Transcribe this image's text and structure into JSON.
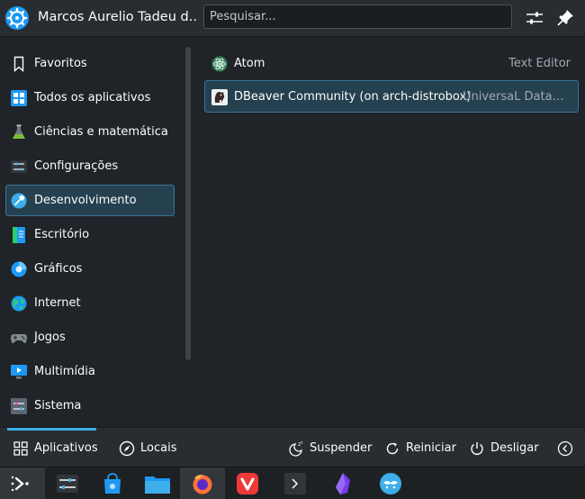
{
  "header": {
    "username": "Marcos Aurelio Tadeu d...",
    "search_placeholder": "Pesquisar..."
  },
  "sidebar": {
    "items": [
      {
        "label": "Favoritos",
        "icon": "bookmark-icon"
      },
      {
        "label": "Todos os aplicativos",
        "icon": "all-apps-icon"
      },
      {
        "label": "Ciências e matemática",
        "icon": "science-icon"
      },
      {
        "label": "Configurações",
        "icon": "settings-icon"
      },
      {
        "label": "Desenvolvimento",
        "icon": "development-icon",
        "active": true
      },
      {
        "label": "Escritório",
        "icon": "office-icon"
      },
      {
        "label": "Gráficos",
        "icon": "graphics-icon"
      },
      {
        "label": "Internet",
        "icon": "internet-icon"
      },
      {
        "label": "Jogos",
        "icon": "games-icon"
      },
      {
        "label": "Multimídia",
        "icon": "multimedia-icon"
      },
      {
        "label": "Sistema",
        "icon": "system-icon"
      }
    ]
  },
  "apps": [
    {
      "name": "Atom",
      "description": "Text Editor",
      "icon": "atom-icon"
    },
    {
      "name": "DBeaver Community  (on arch-distrobox)",
      "description": "UniversaL Databa...",
      "icon": "dbeaver-icon",
      "selected": true
    }
  ],
  "footer": {
    "tabs": [
      {
        "label": "Aplicativos",
        "icon": "apps-grid-icon",
        "active": true
      },
      {
        "label": "Locais",
        "icon": "compass-icon"
      }
    ],
    "actions": [
      {
        "label": "Suspender",
        "icon": "sleep-icon"
      },
      {
        "label": "Reiniciar",
        "icon": "restart-icon"
      },
      {
        "label": "Desligar",
        "icon": "power-icon"
      }
    ]
  },
  "taskbar": {
    "items": [
      {
        "icon": "app-launcher-icon",
        "active": true
      },
      {
        "icon": "system-settings-icon"
      },
      {
        "icon": "discover-store-icon"
      },
      {
        "icon": "file-manager-icon"
      },
      {
        "icon": "firefox-icon"
      },
      {
        "icon": "vivaldi-icon"
      },
      {
        "icon": "terminal-icon"
      },
      {
        "icon": "obsidian-icon"
      },
      {
        "icon": "steam-deck-icon"
      }
    ]
  },
  "colors": {
    "accent": "#3daee9",
    "selection_bg": "#25404f",
    "selection_border": "#3a7699",
    "background": "#202327",
    "header_bg": "#292c31"
  }
}
